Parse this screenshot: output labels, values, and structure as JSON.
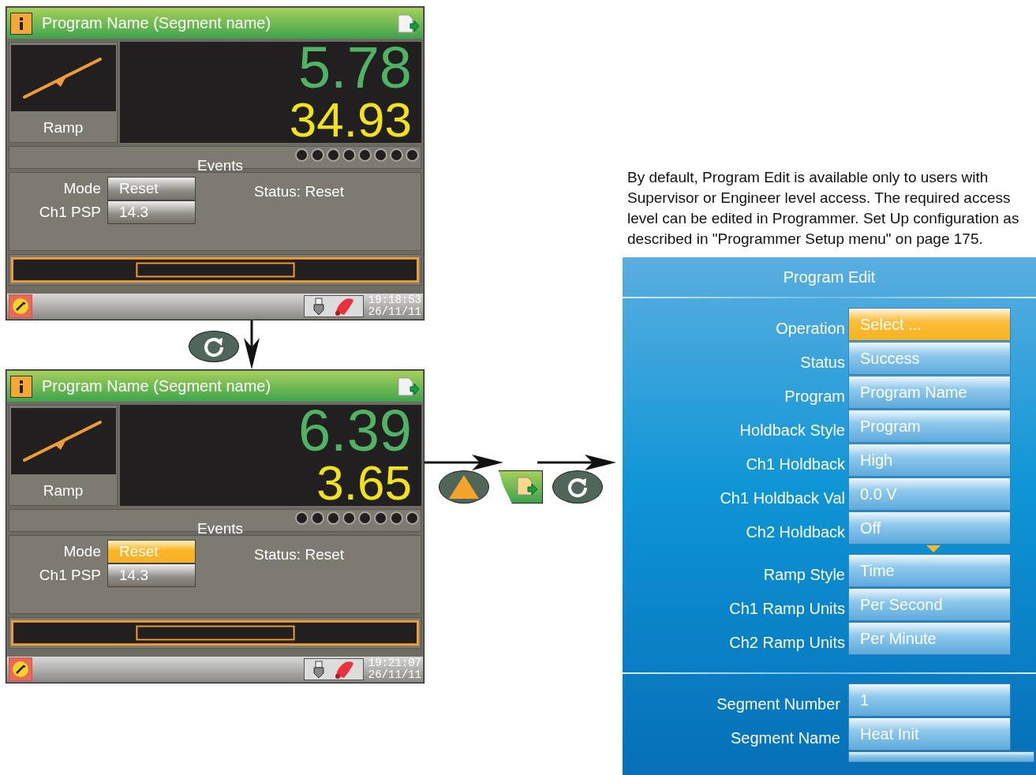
{
  "screens": [
    {
      "title": "Program Name (Segment name)",
      "segment_type": "Ramp",
      "value_1": "5.78",
      "value_2": "34.93",
      "events_label": "Events",
      "fields": [
        {
          "label": "Mode",
          "value": "Reset",
          "selected": false
        },
        {
          "label": "Ch1 PSP",
          "value": "14.3",
          "selected": false
        }
      ],
      "status": "Status: Reset",
      "time": "19:18:53",
      "date": "26/11/11"
    },
    {
      "title": "Program Name (Segment name)",
      "segment_type": "Ramp",
      "value_1": "6.39",
      "value_2": "3.65",
      "events_label": "Events",
      "fields": [
        {
          "label": "Mode",
          "value": "Reset",
          "selected": true
        },
        {
          "label": "Ch1 PSP",
          "value": "14.3",
          "selected": false
        }
      ],
      "status": "Status: Reset",
      "time": "19:21:07",
      "date": "26/11/11"
    }
  ],
  "note": "By default, Program Edit is available only to users with Supervisor or Engineer level access. The required access level can be edited in Programmer. Set Up configuration as described in \"Programmer Setup menu\" on page 175.",
  "program_edit": {
    "title": "Program Edit",
    "fields": [
      {
        "label": "Operation",
        "value": "Select ...",
        "selected": true
      },
      {
        "label": "Status",
        "value": "Success",
        "selected": false
      },
      {
        "label": "Program",
        "value": "Program Name",
        "selected": false
      },
      {
        "label": "Holdback Style",
        "value": "Program",
        "selected": false
      },
      {
        "label": "Ch1 Holdback",
        "value": "High",
        "selected": false
      },
      {
        "label": "Ch1 Holdback Val",
        "value": "0.0 V",
        "selected": false
      },
      {
        "label": "Ch2 Holdback",
        "value": "Off",
        "selected": false
      },
      {
        "label": "Ramp Style",
        "value": "Time",
        "selected": false
      },
      {
        "label": "Ch1 Ramp Units",
        "value": "Per Second",
        "selected": false
      },
      {
        "label": "Ch2 Ramp Units",
        "value": "Per Minute",
        "selected": false
      }
    ],
    "segment_fields": [
      {
        "label": "Segment Number",
        "value": "1",
        "selected": false
      },
      {
        "label": "Segment Name",
        "value": "Heat Init",
        "selected": false
      }
    ]
  }
}
